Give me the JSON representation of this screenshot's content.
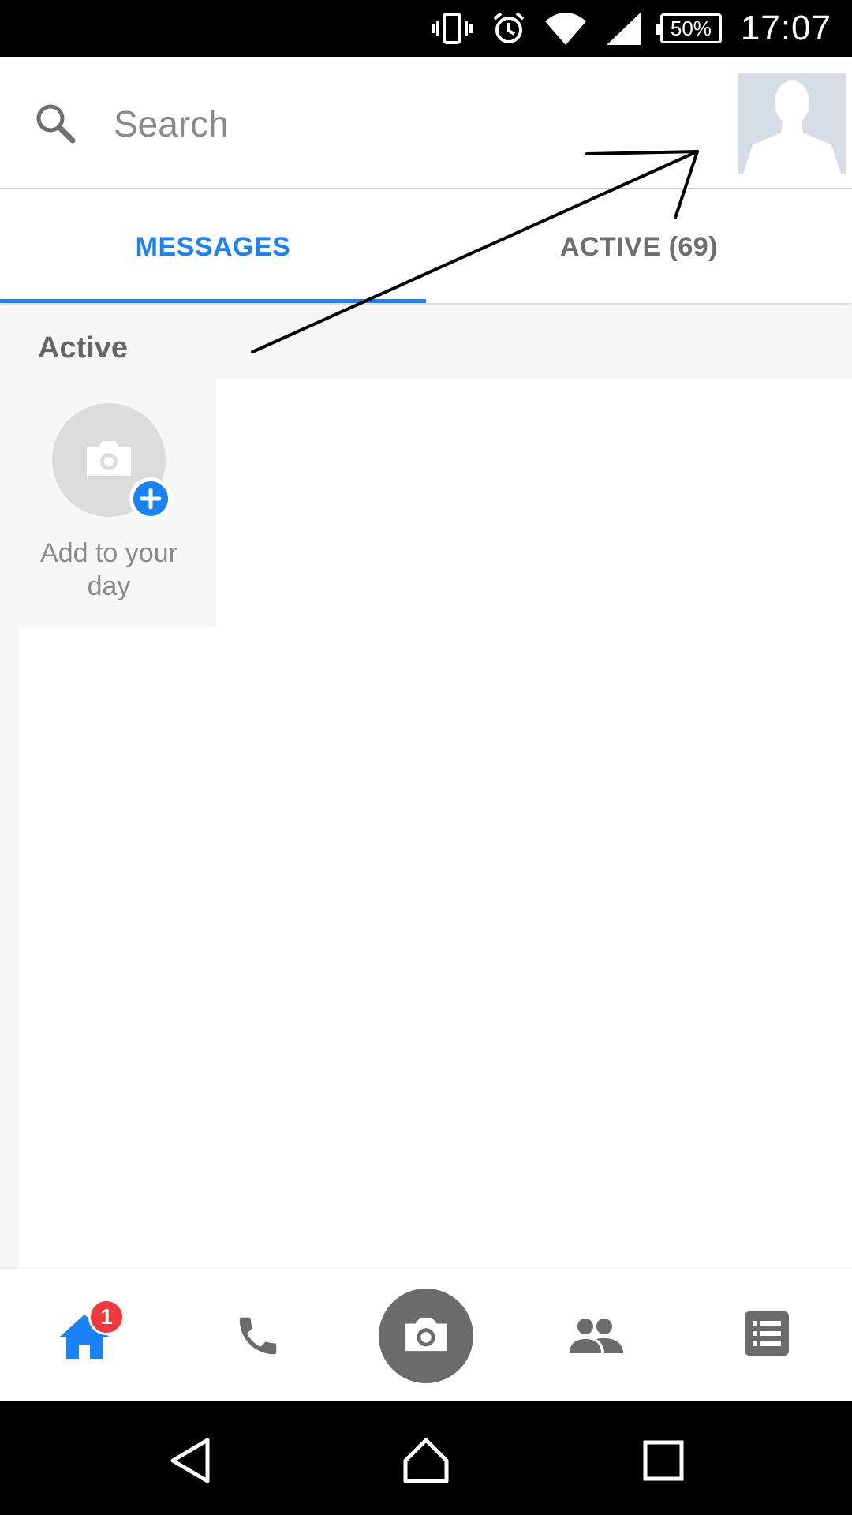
{
  "status_bar": {
    "battery_percent": "50%",
    "time": "17:07",
    "icons": [
      "vibrate-icon",
      "alarm-icon",
      "wifi-icon",
      "signal-icon",
      "battery-icon"
    ]
  },
  "search": {
    "placeholder": "Search",
    "value": ""
  },
  "tabs": [
    {
      "label": "MESSAGES",
      "selected": true
    },
    {
      "label": "ACTIVE (69)",
      "selected": false
    }
  ],
  "active_section": {
    "title": "Active",
    "story_card": {
      "label": "Add to your day"
    }
  },
  "bottom_nav": {
    "items": [
      "home-icon",
      "phone-icon",
      "camera-icon",
      "people-icon",
      "discover-list-icon"
    ],
    "home_badge": "1"
  },
  "android_nav": {
    "items": [
      "back-icon",
      "home-icon",
      "recents-icon"
    ]
  },
  "colors": {
    "accent": "#1a82f7",
    "badge": "#f0373c",
    "inactive_text": "#6e6e6e"
  }
}
